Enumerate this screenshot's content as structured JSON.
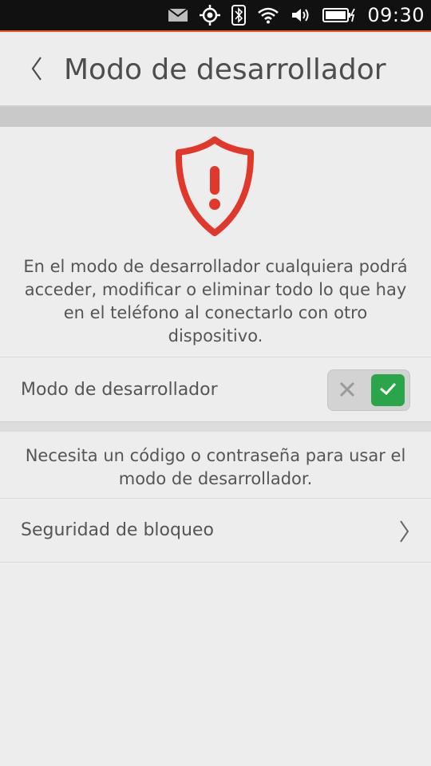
{
  "status_bar": {
    "time": "09:30",
    "icons": [
      "mail-icon",
      "gps-icon",
      "bluetooth-icon",
      "wifi-icon",
      "volume-icon",
      "battery-charging-icon"
    ]
  },
  "header": {
    "title": "Modo de desarrollador",
    "back_icon": "chevron-left-icon"
  },
  "warning": {
    "icon": "shield-warning-icon",
    "text": "En el modo de desarrollador cualquiera podrá acceder, modificar o eliminar todo lo que hay en el teléfono al conectarlo con otro dispositivo."
  },
  "developer_mode": {
    "label": "Modo de desarrollador",
    "enabled": true
  },
  "info": {
    "text": "Necesita un código o contraseña para usar el modo de desarrollador."
  },
  "lock_security": {
    "label": "Seguridad de bloqueo",
    "icon": "chevron-right-icon"
  },
  "colors": {
    "accent": "#e95420",
    "warning_red": "#e0392b",
    "toggle_on": "#2aa54a",
    "background": "#ededed"
  }
}
